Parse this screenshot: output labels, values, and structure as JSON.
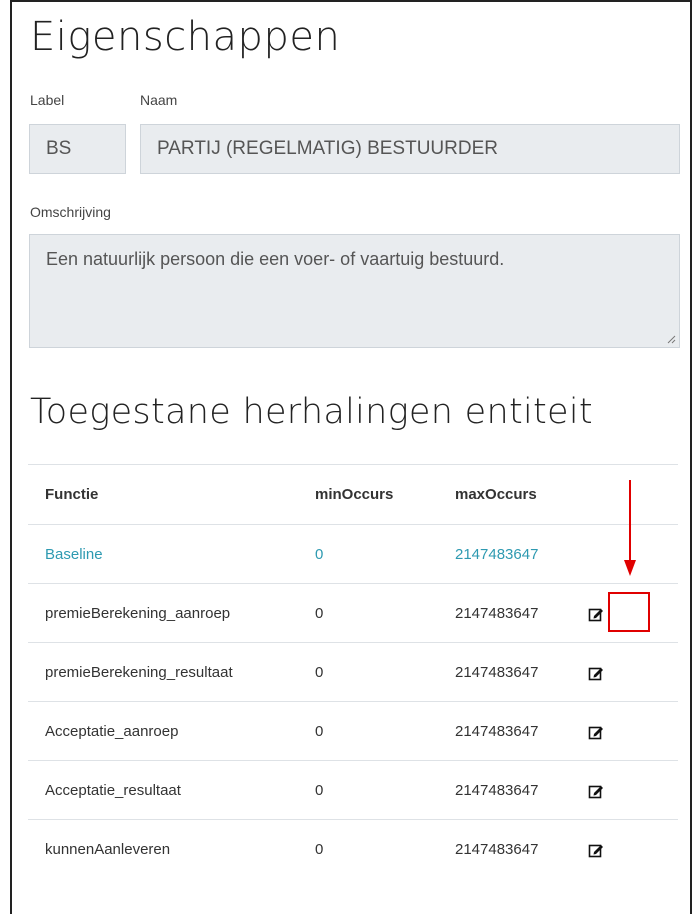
{
  "properties": {
    "title": "Eigenschappen",
    "label_caption": "Label",
    "name_caption": "Naam",
    "label_value": "BS",
    "name_value": "PARTIJ (REGELMATIG) BESTUURDER",
    "description_caption": "Omschrijving",
    "description_value": "Een natuurlijk persoon die een voer- of vaartuig bestuurd."
  },
  "repetitions": {
    "title": "Toegestane herhalingen entiteit",
    "columns": [
      "Functie",
      "minOccurs",
      "maxOccurs"
    ],
    "rows": [
      {
        "function": "Baseline",
        "min": "0",
        "max": "2147483647",
        "editable": false,
        "link": true
      },
      {
        "function": "premieBerekening_aanroep",
        "min": "0",
        "max": "2147483647",
        "editable": true,
        "highlighted": true
      },
      {
        "function": "premieBerekening_resultaat",
        "min": "0",
        "max": "2147483647",
        "editable": true
      },
      {
        "function": "Acceptatie_aanroep",
        "min": "0",
        "max": "2147483647",
        "editable": true
      },
      {
        "function": "Acceptatie_resultaat",
        "min": "0",
        "max": "2147483647",
        "editable": true
      },
      {
        "function": "kunnenAanleveren",
        "min": "0",
        "max": "2147483647",
        "editable": true
      }
    ]
  },
  "colors": {
    "link": "#2e9ab1",
    "highlight": "#e00000",
    "field_bg": "#e9ecef"
  }
}
